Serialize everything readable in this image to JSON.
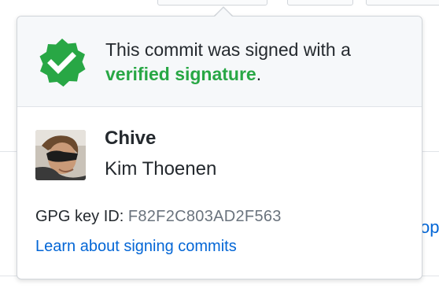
{
  "popover": {
    "status_prefix": "This commit was signed with a ",
    "status_verified": "verified signature",
    "status_suffix": ".",
    "user_login": "Chive",
    "user_fullname": "Kim Thoenen",
    "gpg_label": "GPG key ID: ",
    "gpg_key_id": "F82F2C803AD2F563",
    "learn_link": "Learn about signing commits",
    "icon": "verified-badge-icon"
  },
  "background": {
    "partial_link_text": "op"
  },
  "colors": {
    "verified_green": "#28a745",
    "link_blue": "#0366d6",
    "header_bg": "#f6f8fa",
    "border": "#d1d5da",
    "text": "#24292e",
    "muted": "#6a737d"
  }
}
